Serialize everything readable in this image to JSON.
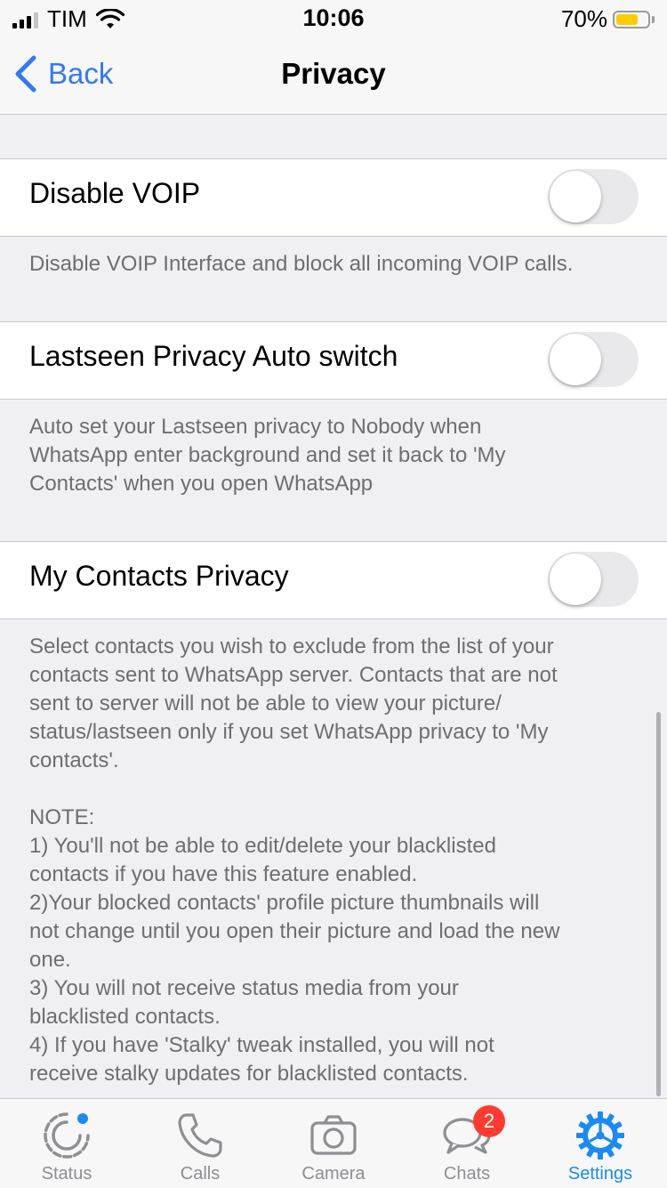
{
  "status_bar": {
    "carrier": "TIM",
    "time": "10:06",
    "battery_percent": "70%",
    "battery_level": 0.7,
    "battery_color": "#ffcc00",
    "signal_bars": 3
  },
  "nav": {
    "back_label": "Back",
    "title": "Privacy"
  },
  "settings": [
    {
      "label": "Disable VOIP",
      "enabled": false,
      "footer": "Disable VOIP Interface and block all incoming VOIP calls."
    },
    {
      "label": "Lastseen Privacy Auto switch",
      "enabled": false,
      "footer": "Auto set your Lastseen privacy to Nobody when\nWhatsApp enter background and set it back to 'My\nContacts' when you open WhatsApp"
    },
    {
      "label": "My Contacts Privacy",
      "enabled": false,
      "footer": "Select contacts you wish to exclude from the list of your\ncontacts sent to WhatsApp server. Contacts that are not\nsent to server will not be able to view your picture/\nstatus/lastseen only if you set WhatsApp privacy to 'My\ncontacts'.\n\nNOTE:\n1) You'll not be able to edit/delete your blacklisted\ncontacts if you have this feature enabled.\n2)Your blocked contacts' profile picture thumbnails will\nnot change until you open their picture and load the new\none.\n3) You will not receive status media from your\nblacklisted contacts.\n4) If you have 'Stalky' tweak installed, you will not\nreceive stalky updates for blacklisted contacts."
    }
  ],
  "tabs": [
    {
      "label": "Status",
      "icon": "status-icon",
      "active": false
    },
    {
      "label": "Calls",
      "icon": "phone-icon",
      "active": false
    },
    {
      "label": "Camera",
      "icon": "camera-icon",
      "active": false
    },
    {
      "label": "Chats",
      "icon": "chat-bubbles-icon",
      "active": false,
      "badge": "2"
    },
    {
      "label": "Settings",
      "icon": "gear-icon",
      "active": true
    }
  ],
  "colors": {
    "accent": "#1a8bf4",
    "back_link": "#3478f6",
    "badge": "#ff3b30",
    "toggle_off": "#e9e9eb"
  }
}
